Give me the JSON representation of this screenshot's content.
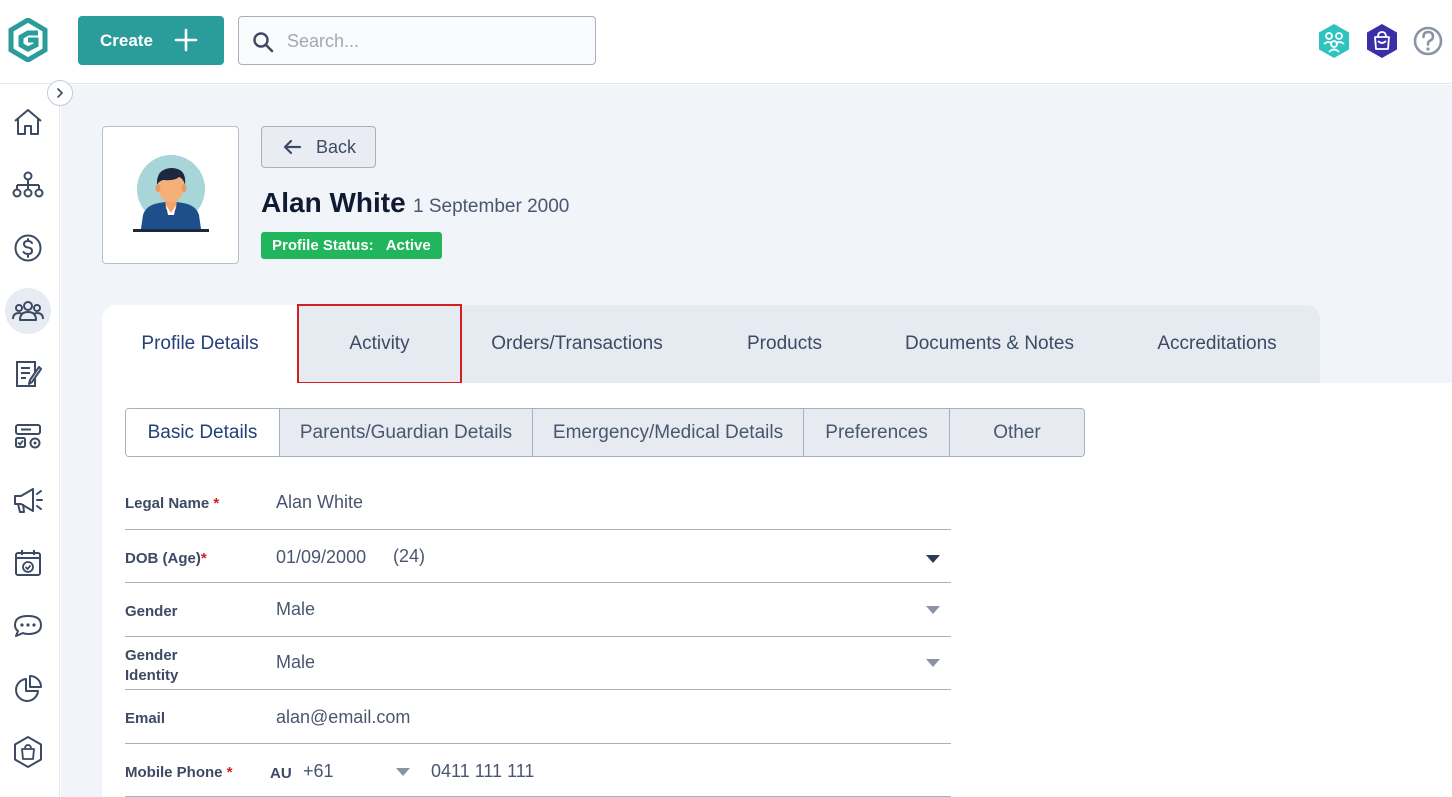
{
  "header": {
    "create_label": "Create",
    "search_placeholder": "Search...",
    "icons": [
      "app-logo-icon",
      "plus-icon",
      "search-icon",
      "members-hub-icon",
      "shop-icon",
      "help-icon"
    ]
  },
  "sidebar": {
    "items": [
      {
        "icon": "home-icon",
        "active": false
      },
      {
        "icon": "org-structure-icon",
        "active": false
      },
      {
        "icon": "finance-icon",
        "active": false
      },
      {
        "icon": "members-icon",
        "active": true
      },
      {
        "icon": "registrations-icon",
        "active": false
      },
      {
        "icon": "competitions-icon",
        "active": false
      },
      {
        "icon": "marketing-icon",
        "active": false
      },
      {
        "icon": "events-calendar-icon",
        "active": false
      },
      {
        "icon": "communications-icon",
        "active": false
      },
      {
        "icon": "reports-icon",
        "active": false
      },
      {
        "icon": "shop-bag-icon",
        "active": false
      }
    ]
  },
  "profile": {
    "back_label": "Back",
    "name": "Alan White",
    "dob": "1 September 2000",
    "status_label": "Profile Status:",
    "status_value": "Active",
    "colors": {
      "status": "#21b55d",
      "accent": "#2a9d9a",
      "highlight": "#d21f1f"
    }
  },
  "tabs": [
    {
      "label": "Profile Details",
      "active": true
    },
    {
      "label": "Activity",
      "active": false,
      "highlighted": true
    },
    {
      "label": "Orders/Transactions",
      "active": false
    },
    {
      "label": "Products",
      "active": false
    },
    {
      "label": "Documents & Notes",
      "active": false
    },
    {
      "label": "Accreditations",
      "active": false
    }
  ],
  "subtabs": [
    {
      "label": "Basic Details",
      "active": true
    },
    {
      "label": "Parents/Guardian Details",
      "active": false
    },
    {
      "label": "Emergency/Medical Details",
      "active": false
    },
    {
      "label": "Preferences",
      "active": false
    },
    {
      "label": "Other",
      "active": false
    }
  ],
  "form": {
    "legal_name": {
      "label": "Legal Name",
      "required": "*",
      "value": "Alan White"
    },
    "dob": {
      "label": "DOB (Age)",
      "required": "*",
      "value": "01/09/2000",
      "age": "(24)"
    },
    "gender": {
      "label": "Gender",
      "value": "Male"
    },
    "gender_identity": {
      "label_line1": "Gender",
      "label_line2": "Identity",
      "value": "Male"
    },
    "email": {
      "label": "Email",
      "value": "alan@email.com"
    },
    "mobile": {
      "label": "Mobile Phone",
      "required": "*",
      "country": "AU",
      "code": "+61",
      "number": "0411 111 111"
    }
  }
}
